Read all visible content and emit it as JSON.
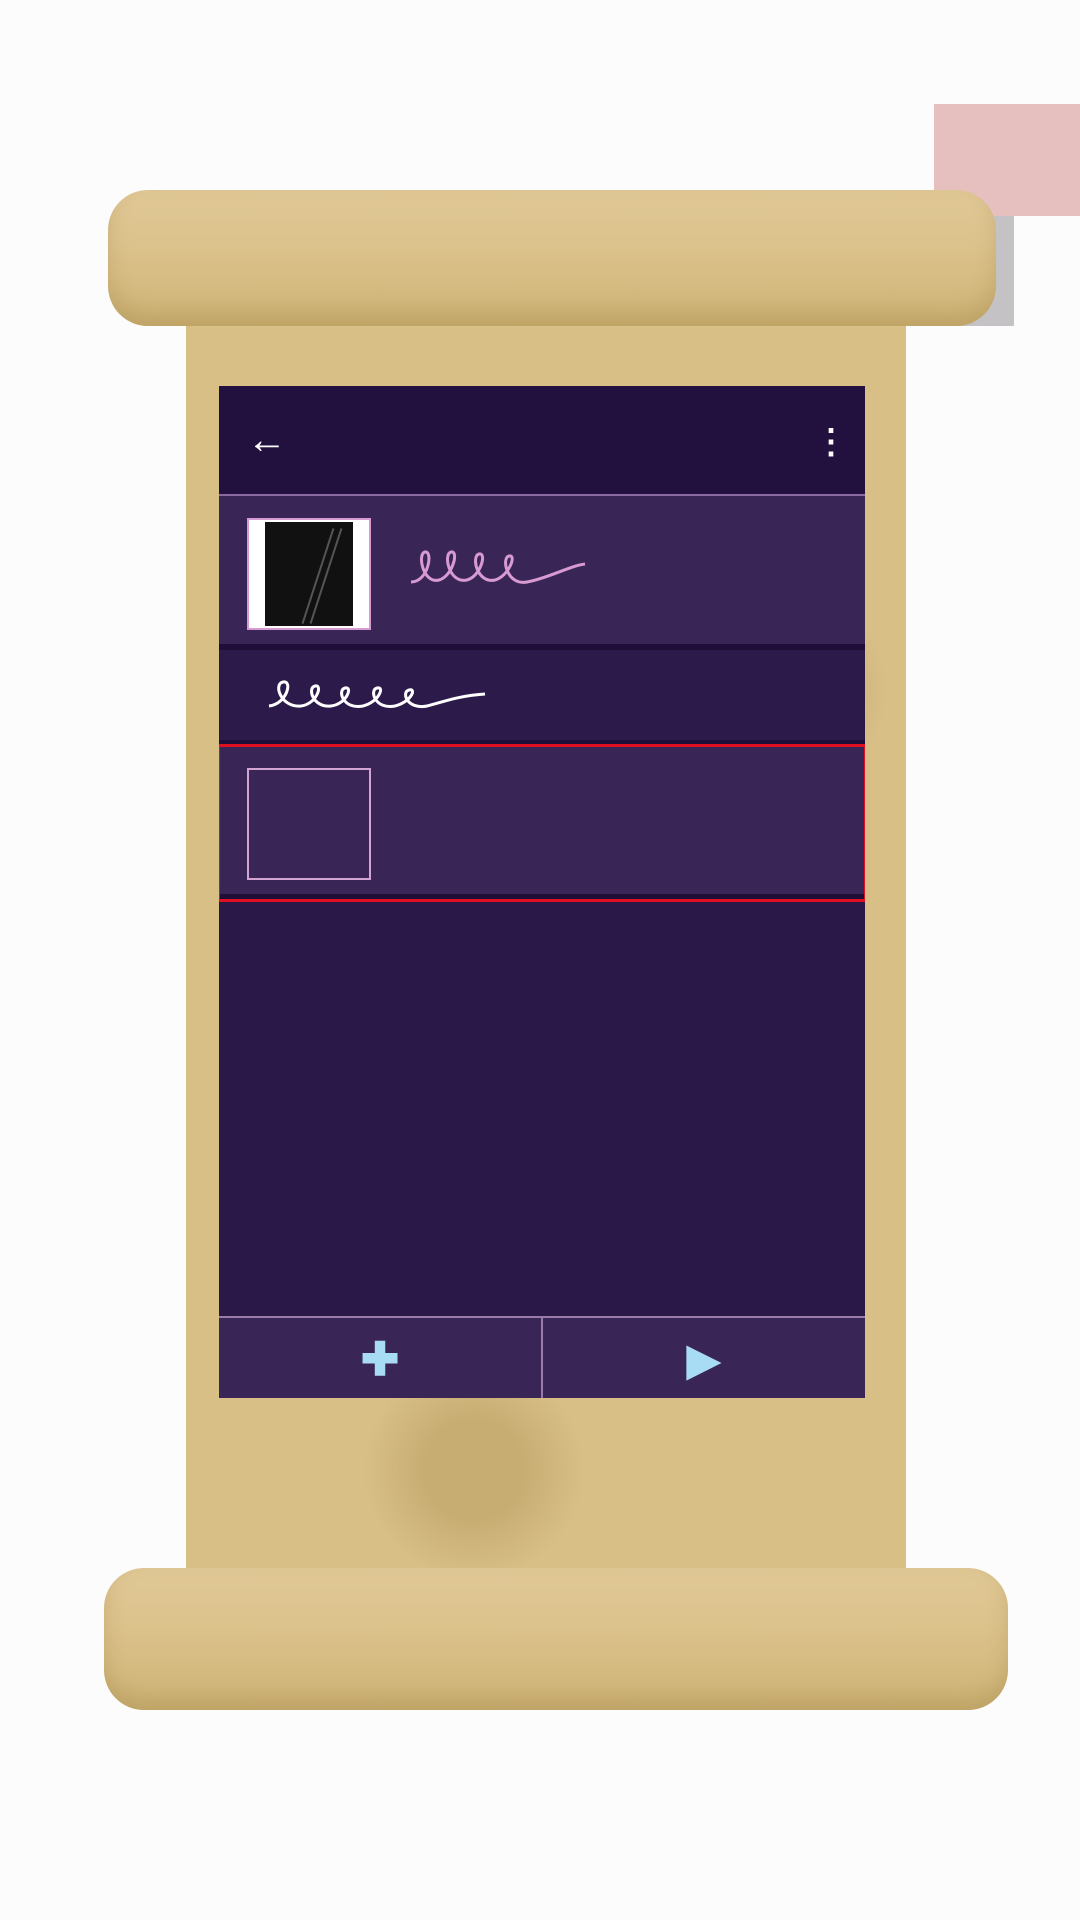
{
  "appbar": {
    "back_icon": "←",
    "title": "",
    "menu_icon": "⋮"
  },
  "list": {
    "items": [
      {
        "type": "folder-with-thumb",
        "label_scribble": "handwritten-label",
        "selected": false
      },
      {
        "type": "plain",
        "label_scribble": "handwritten-label",
        "selected": false
      },
      {
        "type": "folder-empty-thumb",
        "label_scribble": "",
        "selected": true
      }
    ]
  },
  "bottombar": {
    "add_icon": "✚",
    "play_icon": "▶"
  },
  "colors": {
    "screen_bg": "#2a1848",
    "appbar_bg": "#22113f",
    "row_bg": "#3a2656",
    "accent_pink": "#d79ad2",
    "icon_blue": "#a8dcf5",
    "selection_red": "#e01020",
    "parchment": "#d8bf85"
  }
}
